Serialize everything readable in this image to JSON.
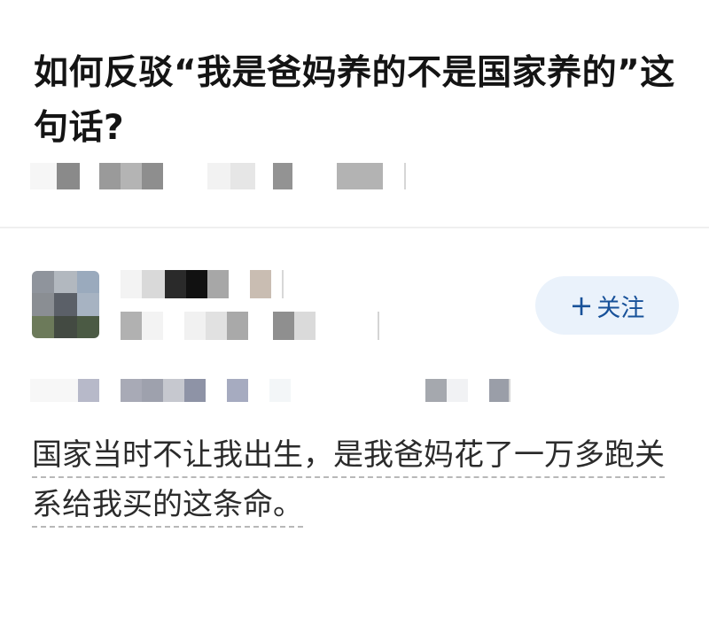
{
  "question": {
    "title": "如何反驳“我是爸妈养的不是国家养的”这句话?"
  },
  "author": {
    "follow_label": "关注",
    "follow_icon": "plus-icon"
  },
  "answer": {
    "text": "国家当时不让我出生，是我爸妈花了一万多跑关系给我买的这条命。"
  },
  "colors": {
    "follow_bg": "#eaf2fb",
    "follow_text": "#175199",
    "underline": "#b8b8b8"
  }
}
